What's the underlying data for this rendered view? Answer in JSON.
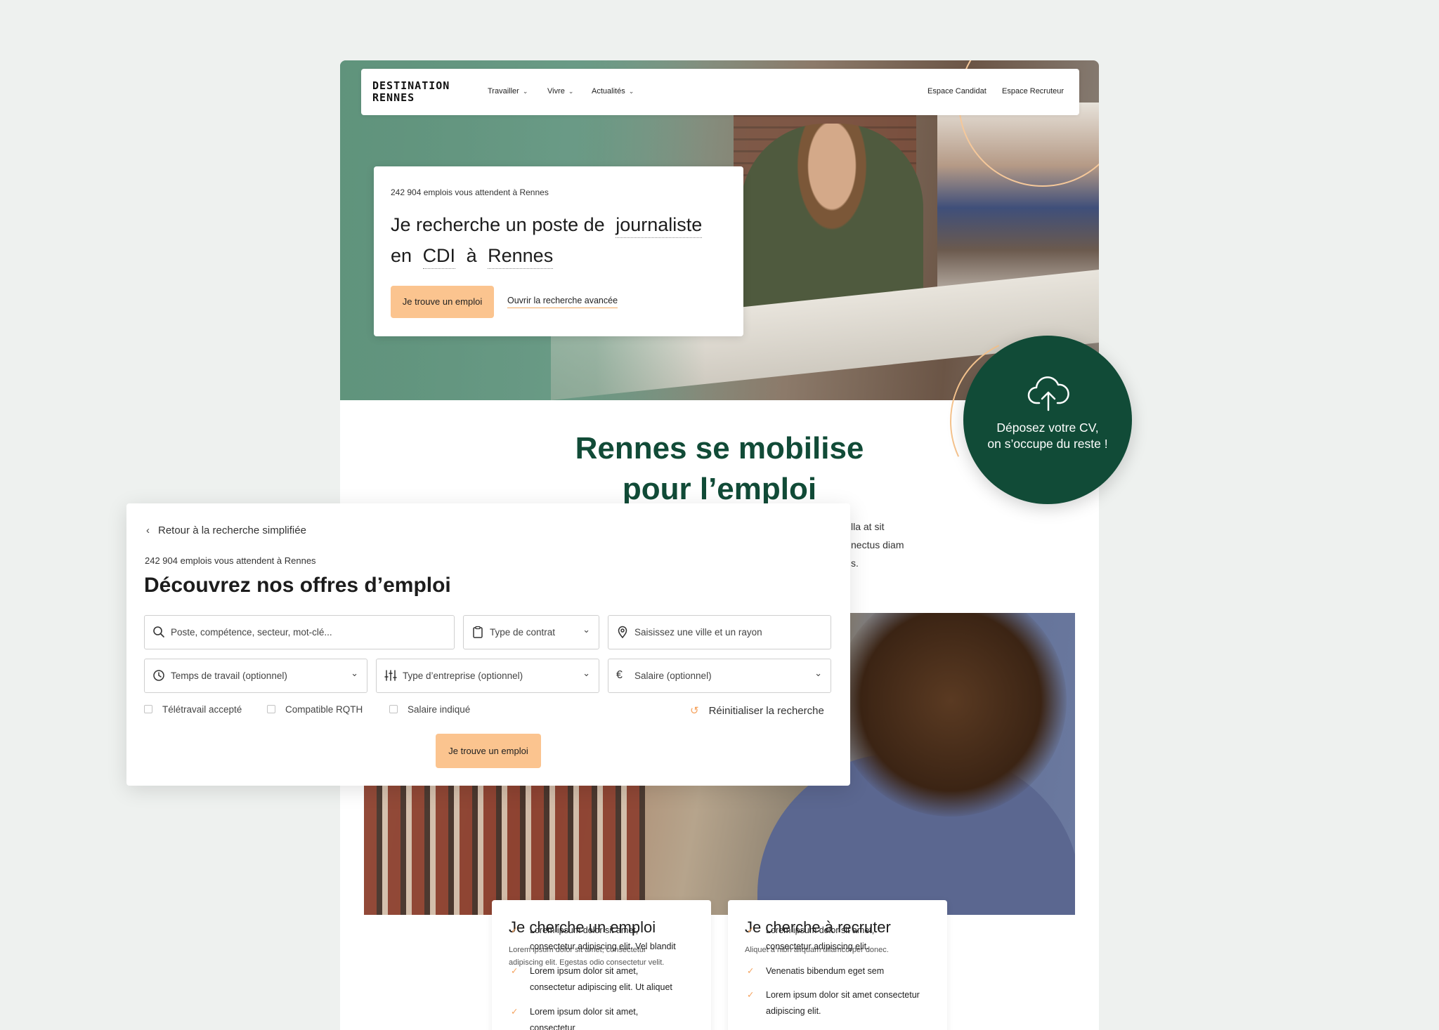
{
  "nav": {
    "logo_line1": "DESTINATION",
    "logo_line2": "RENNES",
    "items": [
      "Travailler",
      "Vivre",
      "Actualités"
    ],
    "candidate": "Espace Candidat",
    "recruiter": "Espace Recruteur"
  },
  "hero": {
    "count": "242 904 emplois vous attendent à Rennes",
    "line1_prefix": "Je recherche un poste de",
    "job": "journaliste",
    "line2_en": "en",
    "contract": "CDI",
    "line2_a": "à",
    "city": "Rennes",
    "button": "Je trouve un emploi",
    "advanced_link": "Ouvrir la recherche avancée"
  },
  "cv": {
    "line1": "Déposez votre CV,",
    "line2": "on s’occupe du reste !"
  },
  "section": {
    "title_line1": "Rennes se mobilise",
    "title_line2": "pour l’emploi",
    "para_line1": "lla at sit",
    "para_line2": "nectus diam",
    "para_line3": "s."
  },
  "advanced": {
    "back": "Retour à la recherche simplifiée",
    "count": "242 904 emplois vous attendent à Rennes",
    "title": "Découvrez nos offres d’emploi",
    "keyword_placeholder": "Poste, compétence, secteur, mot-clé...",
    "contract_type": "Type de contrat",
    "location_placeholder": "Saisissez une ville et un rayon",
    "work_time": "Temps de travail (optionnel)",
    "company_type": "Type d’entreprise (optionnel)",
    "salary": "Salaire (optionnel)",
    "checkboxes": [
      "Télétravail accepté",
      "Compatible RQTH",
      "Salaire indiqué"
    ],
    "reset": "Réinitialiser la recherche",
    "button": "Je trouve un emploi"
  },
  "cards": [
    {
      "title": "Je cherche un emploi",
      "sub_line1": "Lorem ipsum dolor sit amet, consectetur",
      "sub_line2": "adipiscing elit. Egestas odio consectetur velit.",
      "items": [
        [
          "Lorem ipsum dolor sit amet,",
          "consectetur adipiscing elit. Vel blandit"
        ],
        [
          "Lorem ipsum dolor sit amet,",
          "consectetur adipiscing elit. Ut aliquet"
        ],
        [
          "Lorem ipsum dolor sit amet,",
          "consectetur"
        ]
      ]
    },
    {
      "title": "Je cherche à recruter",
      "sub_line1": "Aliquet a nibh aliquam ullamcorper donec.",
      "sub_line2": "",
      "items": [
        [
          "Lorem ipsum dolor sit amet,",
          "consectetur adipiscing elit."
        ],
        [
          "Venenatis bibendum eget sem",
          ""
        ],
        [
          "Lorem ipsum dolor sit amet consectetur",
          "adipiscing elit."
        ]
      ]
    }
  ],
  "colors": {
    "brand_green": "#114b37",
    "accent_orange": "#fbc48f",
    "background": "#eef1ef"
  }
}
